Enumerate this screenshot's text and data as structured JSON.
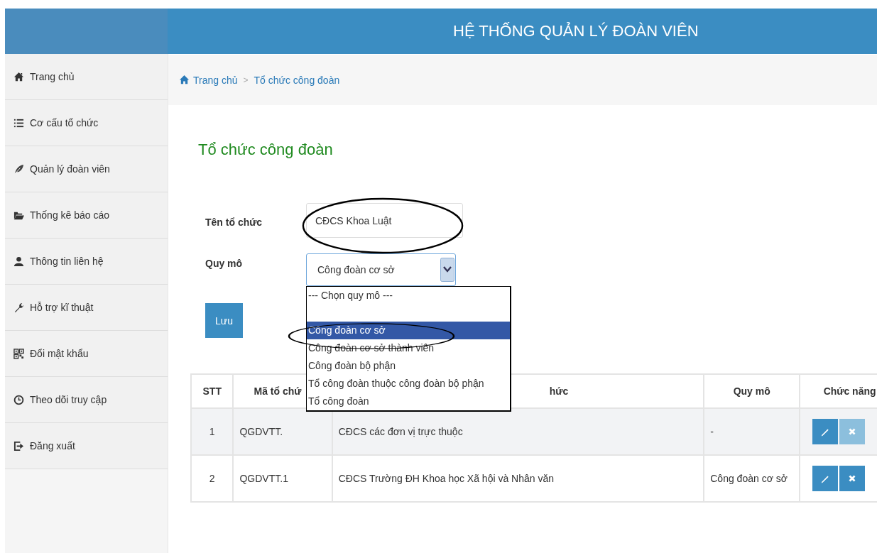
{
  "header": {
    "title": "HỆ THỐNG QUẢN LÝ ĐOÀN VIÊN"
  },
  "sidebar": {
    "items": [
      {
        "label": "Trang chủ"
      },
      {
        "label": "Cơ cấu tổ chức"
      },
      {
        "label": "Quản lý đoàn viên"
      },
      {
        "label": "Thống kê báo cáo"
      },
      {
        "label": "Thông tin liên hệ"
      },
      {
        "label": "Hỗ trợ kĩ thuật"
      },
      {
        "label": "Đổi mật khẩu"
      },
      {
        "label": "Theo dõi truy cập"
      },
      {
        "label": "Đăng xuất"
      }
    ]
  },
  "breadcrumb": [
    "Trang chủ",
    "Tổ chức công đoàn"
  ],
  "breadcrumb_separator": ">",
  "page_title": "Tổ chức công đoàn",
  "form": {
    "name_label": "Tên tổ chức",
    "name_value": "CĐCS Khoa Luật",
    "scale_label": "Quy mô",
    "scale_value": "Công đoàn cơ sở",
    "save_button": "Lưu",
    "dropdown": {
      "expanded": true,
      "options": [
        {
          "label": "--- Chọn quy mô ---",
          "selected": false
        },
        {
          "label": "Công đoàn cơ sở",
          "selected": true
        },
        {
          "label": "Công đoàn cơ sở thành viên",
          "selected": false
        },
        {
          "label": "Công đoàn bộ phận",
          "selected": false
        },
        {
          "label": "Tổ công đoàn thuộc công đoàn bộ phận",
          "selected": false
        },
        {
          "label": "Tổ công đoàn",
          "selected": false
        }
      ]
    }
  },
  "table": {
    "columns": [
      "STT",
      "Mã tổ chứ",
      "hức",
      "Quy mô",
      "Chức năng"
    ],
    "rows": [
      {
        "cells": [
          "1",
          "QGDVTT.",
          "CĐCS các đơn vị trực thuộc",
          "-"
        ],
        "delete_disabled": true
      },
      {
        "cells": [
          "2",
          "QGDVTT.1",
          "CĐCS Trường ĐH Khoa học Xã hội và Nhân văn",
          "Công đoàn cơ sở"
        ],
        "delete_disabled": false
      }
    ]
  }
}
